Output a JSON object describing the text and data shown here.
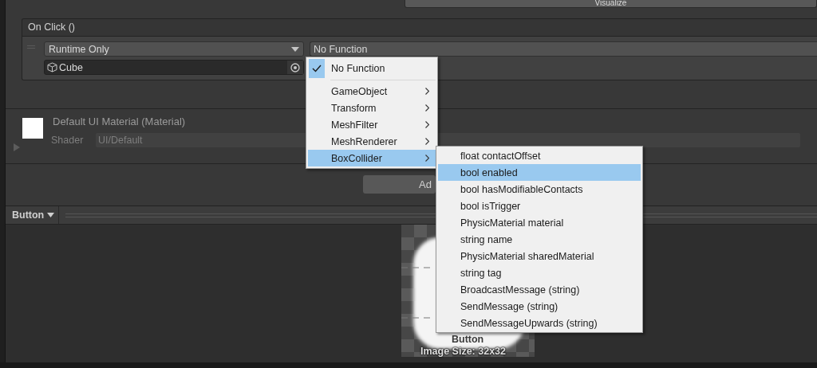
{
  "top_button": {
    "label": "Visualize"
  },
  "event": {
    "title": "On Click ()",
    "listeners": [
      {
        "runtime": "Runtime Only",
        "target": "Cube",
        "function": "No Function"
      }
    ]
  },
  "material": {
    "name": "Default UI Material (Material)",
    "shader_label": "Shader",
    "shader": "UI/Default"
  },
  "add_component": {
    "label": "Ad"
  },
  "preview": {
    "title": "Button",
    "caption": "Button",
    "size": "Image Size: 32x32"
  },
  "function_menu": {
    "items": [
      {
        "label": "No Function",
        "kind": "option",
        "checked": true,
        "selected": false
      },
      {
        "label": "GameObject",
        "kind": "submenu",
        "selected": false
      },
      {
        "label": "Transform",
        "kind": "submenu",
        "selected": false
      },
      {
        "label": "MeshFilter",
        "kind": "submenu",
        "selected": false
      },
      {
        "label": "MeshRenderer",
        "kind": "submenu",
        "selected": false
      },
      {
        "label": "BoxCollider",
        "kind": "submenu",
        "selected": true
      }
    ]
  },
  "submenu": {
    "items": [
      {
        "label": "float contactOffset",
        "selected": false
      },
      {
        "label": "bool enabled",
        "selected": true
      },
      {
        "label": "bool hasModifiableContacts",
        "selected": false
      },
      {
        "label": "bool isTrigger",
        "selected": false
      },
      {
        "label": "PhysicMaterial material",
        "selected": false
      },
      {
        "label": "string name",
        "selected": false
      },
      {
        "label": "PhysicMaterial sharedMaterial",
        "selected": false
      },
      {
        "label": "string tag",
        "selected": false
      },
      {
        "label": "BroadcastMessage (string)",
        "selected": false
      },
      {
        "label": "SendMessage (string)",
        "selected": false
      },
      {
        "label": "SendMessageUpwards (string)",
        "selected": false
      }
    ]
  }
}
